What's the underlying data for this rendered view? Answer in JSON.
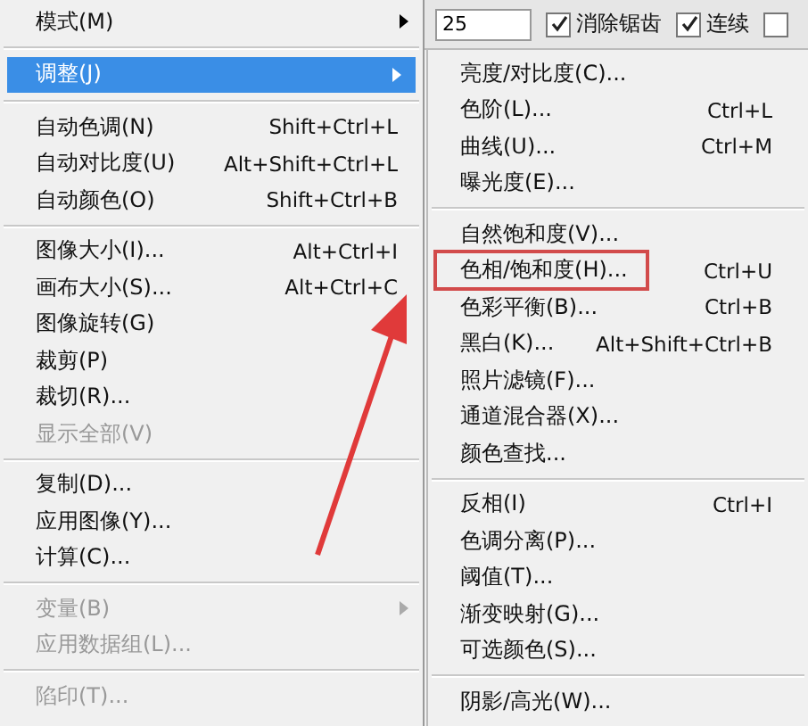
{
  "menu": {
    "items": [
      {
        "kind": "item",
        "label": "模式(M)",
        "submenu": true,
        "disabled": false,
        "selected": false
      },
      {
        "kind": "separator"
      },
      {
        "kind": "item",
        "label": "调整(J)",
        "submenu": true,
        "disabled": false,
        "selected": true
      },
      {
        "kind": "separator"
      },
      {
        "kind": "item",
        "label": "自动色调(N)",
        "shortcut": "Shift+Ctrl+L",
        "disabled": false,
        "selected": false
      },
      {
        "kind": "item",
        "label": "自动对比度(U)",
        "shortcut": "Alt+Shift+Ctrl+L",
        "disabled": false,
        "selected": false
      },
      {
        "kind": "item",
        "label": "自动颜色(O)",
        "shortcut": "Shift+Ctrl+B",
        "disabled": false,
        "selected": false
      },
      {
        "kind": "separator"
      },
      {
        "kind": "item",
        "label": "图像大小(I)...",
        "shortcut": "Alt+Ctrl+I",
        "disabled": false,
        "selected": false
      },
      {
        "kind": "item",
        "label": "画布大小(S)...",
        "shortcut": "Alt+Ctrl+C",
        "disabled": false,
        "selected": false
      },
      {
        "kind": "item",
        "label": "图像旋转(G)",
        "disabled": false,
        "selected": false
      },
      {
        "kind": "item",
        "label": "裁剪(P)",
        "disabled": false,
        "selected": false
      },
      {
        "kind": "item",
        "label": "裁切(R)...",
        "disabled": false,
        "selected": false
      },
      {
        "kind": "item",
        "label": "显示全部(V)",
        "disabled": true,
        "selected": false
      },
      {
        "kind": "separator"
      },
      {
        "kind": "item",
        "label": "复制(D)...",
        "disabled": false,
        "selected": false
      },
      {
        "kind": "item",
        "label": "应用图像(Y)...",
        "disabled": false,
        "selected": false
      },
      {
        "kind": "item",
        "label": "计算(C)...",
        "disabled": false,
        "selected": false
      },
      {
        "kind": "separator"
      },
      {
        "kind": "item",
        "label": "变量(B)",
        "submenu": true,
        "disabled": true,
        "selected": false
      },
      {
        "kind": "item",
        "label": "应用数据组(L)...",
        "disabled": true,
        "selected": false
      },
      {
        "kind": "separator"
      },
      {
        "kind": "item",
        "label": "陷印(T)...",
        "disabled": true,
        "selected": false
      }
    ]
  },
  "toolbar": {
    "tolerance": {
      "value": "25"
    },
    "checkboxes": [
      {
        "label": "消除锯齿",
        "checked": true
      },
      {
        "label": "连续",
        "checked": true
      },
      {
        "checked": false
      }
    ]
  },
  "submenu": {
    "items": [
      {
        "kind": "item",
        "label": "亮度/对比度(C)...",
        "highlighted": false
      },
      {
        "kind": "item",
        "label": "色阶(L)...",
        "shortcut": "Ctrl+L",
        "highlighted": false
      },
      {
        "kind": "item",
        "label": "曲线(U)...",
        "shortcut": "Ctrl+M",
        "highlighted": false
      },
      {
        "kind": "item",
        "label": "曝光度(E)...",
        "highlighted": false
      },
      {
        "kind": "separator"
      },
      {
        "kind": "item",
        "label": "自然饱和度(V)...",
        "highlighted": false
      },
      {
        "kind": "item",
        "label": "色相/饱和度(H)...",
        "shortcut": "Ctrl+U",
        "highlighted": true
      },
      {
        "kind": "item",
        "label": "色彩平衡(B)...",
        "shortcut": "Ctrl+B",
        "highlighted": false
      },
      {
        "kind": "item",
        "label": "黑白(K)...",
        "shortcut": "Alt+Shift+Ctrl+B",
        "highlighted": false
      },
      {
        "kind": "item",
        "label": "照片滤镜(F)...",
        "highlighted": false
      },
      {
        "kind": "item",
        "label": "通道混合器(X)...",
        "highlighted": false
      },
      {
        "kind": "item",
        "label": "颜色查找...",
        "highlighted": false
      },
      {
        "kind": "separator"
      },
      {
        "kind": "item",
        "label": "反相(I)",
        "shortcut": "Ctrl+I",
        "highlighted": false
      },
      {
        "kind": "item",
        "label": "色调分离(P)...",
        "highlighted": false
      },
      {
        "kind": "item",
        "label": "阈值(T)...",
        "highlighted": false
      },
      {
        "kind": "item",
        "label": "渐变映射(G)...",
        "highlighted": false
      },
      {
        "kind": "item",
        "label": "可选颜色(S)...",
        "highlighted": false
      },
      {
        "kind": "separator"
      },
      {
        "kind": "item",
        "label": "阴影/高光(W)...",
        "highlighted": false
      }
    ]
  }
}
